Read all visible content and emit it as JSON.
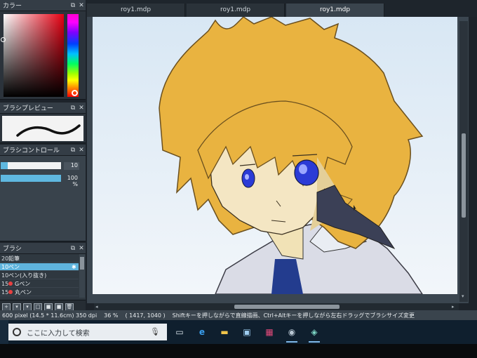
{
  "panels": {
    "color": {
      "title": "カラー"
    },
    "brush_preview": {
      "title": "ブラシプレビュー"
    },
    "brush_control": {
      "title": "ブラシコントロール",
      "size_value": "10",
      "opacity_value": "100 %",
      "size_fraction": 0.12,
      "opacity_fraction": 1.0
    },
    "brush_list": {
      "title": "ブラシ",
      "items": [
        {
          "num": "20",
          "name": "鉛筆"
        },
        {
          "num": "10",
          "name": "ペン"
        },
        {
          "num": "10",
          "name": "ペン(入り抜き)"
        },
        {
          "num": "15",
          "name": "Gペン"
        },
        {
          "num": "15",
          "name": "丸ペン"
        }
      ],
      "selected_index": 1
    }
  },
  "tabs": [
    {
      "label": "roy1.mdp"
    },
    {
      "label": "roy1.mdp"
    },
    {
      "label": "roy1.mdp"
    }
  ],
  "active_tab": 2,
  "status": {
    "size": "600 pixel  (14.5 * 11.6cm)  350 dpi",
    "zoom": "36 %",
    "coords": "( 1417, 1040 )",
    "hint": "Shiftキーを押しながらで直線描画、Ctrl+Altキーを押しながら左右ドラッグでブラシサイズ変更"
  },
  "taskbar": {
    "search_placeholder": "ここに入力して検索",
    "icons": [
      "task-view-icon",
      "edge-icon",
      "explorer-icon",
      "store-icon",
      "gift-icon",
      "media-icon",
      "paint-app-icon"
    ]
  },
  "colors": {
    "accent": "#5fb4dd",
    "hair": "#e9b340",
    "skin": "#f4e6c3",
    "eyes": "#2b3bd6",
    "sky": "#e2eef7"
  }
}
